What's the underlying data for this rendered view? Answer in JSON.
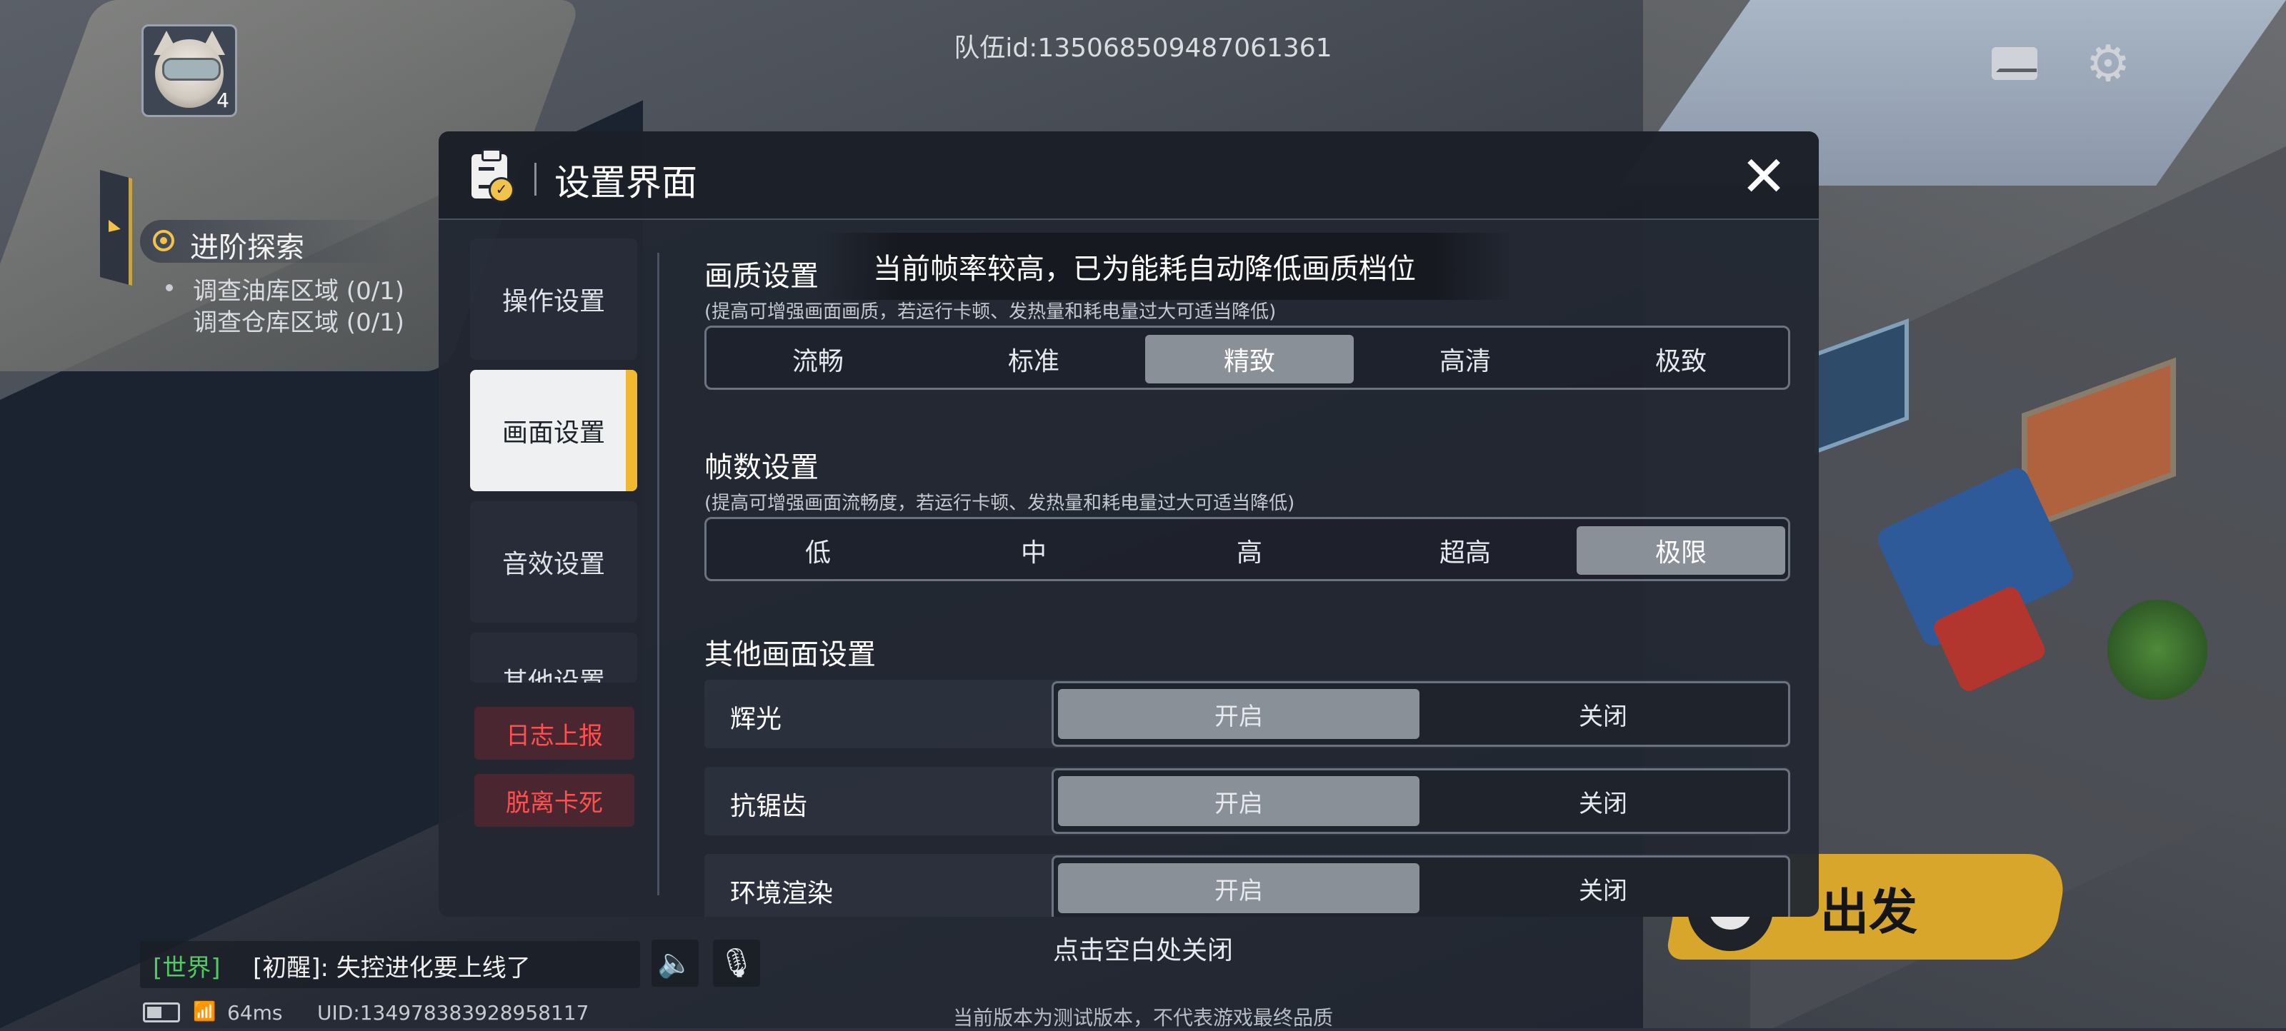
{
  "hud": {
    "team_id": "队伍id:1350685094870613​61",
    "avatar_level": "4",
    "quest_title": "进阶探索",
    "quest_items": [
      "调查油库区域 (0/1)",
      "调查仓库区域 (0/1)"
    ]
  },
  "dialog": {
    "title": "设置界面",
    "toast": "当前帧率较高，已为能耗自动降低画质档位",
    "sidebar": [
      {
        "label": "操作设置",
        "active": false
      },
      {
        "label": "画面设置",
        "active": true
      },
      {
        "label": "音效设置",
        "active": false
      },
      {
        "label": "其他设置",
        "active": false
      }
    ],
    "actions": [
      "日志上报",
      "脱离卡死"
    ],
    "quality": {
      "title": "画质设置",
      "note": "(提高可增强画面画质，若运行卡顿、发热量和耗电量过大可适当降低)",
      "options": [
        "流畅",
        "标准",
        "精致",
        "高清",
        "极致"
      ],
      "selected": "精致"
    },
    "fps": {
      "title": "帧数设置",
      "note": "(提高可增强画面流畅度，若运行卡顿、发热量和耗电量过大可适当降低)",
      "options": [
        "低",
        "中",
        "高",
        "超高",
        "极限"
      ],
      "selected": "极限"
    },
    "other": {
      "title": "其他画面设置",
      "rows": [
        {
          "label": "辉光",
          "on": "开启",
          "off": "关闭",
          "selected": "开启"
        },
        {
          "label": "抗锯齿",
          "on": "开启",
          "off": "关闭",
          "selected": "开启"
        },
        {
          "label": "环境渲染",
          "on": "开启",
          "off": "关闭",
          "selected": "开启"
        }
      ]
    }
  },
  "bottom": {
    "tap_close": "点击空白处关闭",
    "depart": "出发",
    "chat_channel": "[世界]",
    "chat_message": "[初醒]: 失控进化要上线了",
    "ping": "64ms",
    "uid": "UID:134978383928958117",
    "footer_note": "当前版本为测试版本，不代表游戏最终品质"
  },
  "colors": {
    "accent": "#f1b92f",
    "danger_text": "#ff4f4f",
    "selected_option": "#8a9097",
    "chat_channel": "#4ecb62",
    "depart_button": "#d8a62a"
  },
  "icons": [
    "avatar",
    "mail-icon",
    "gear-icon",
    "clipboard-check-icon",
    "close-icon",
    "sound-icon",
    "mic-off-icon",
    "battery-icon",
    "wifi-icon",
    "depart-icon"
  ]
}
